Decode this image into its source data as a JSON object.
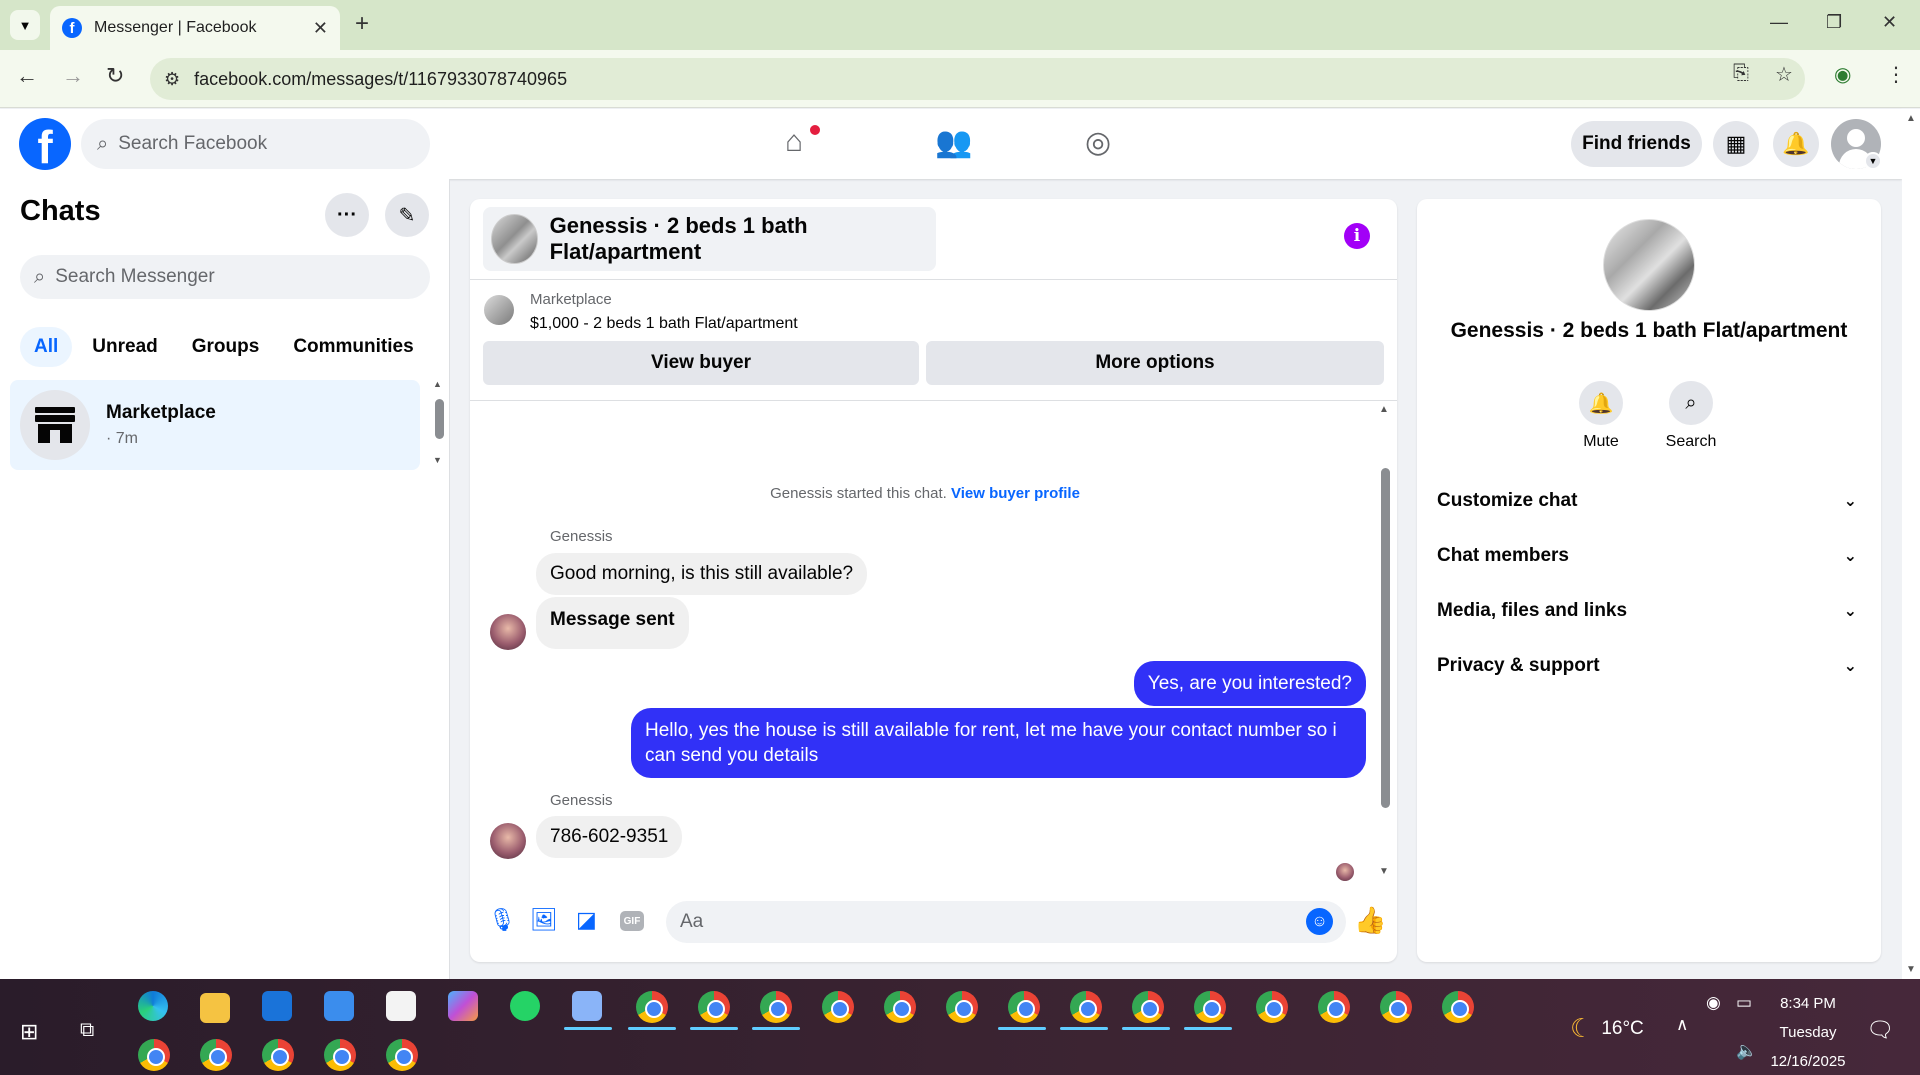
{
  "browser": {
    "tab_title": "Messenger | Facebook",
    "url": "facebook.com/messages/t/1167933078740965"
  },
  "header": {
    "search_placeholder": "Search Facebook",
    "find_friends": "Find friends"
  },
  "sidebar": {
    "title": "Chats",
    "search_placeholder": "Search Messenger",
    "filters": [
      "All",
      "Unread",
      "Groups",
      "Communities"
    ],
    "active_filter": "All",
    "chats": [
      {
        "name": "Marketplace",
        "time": "· 7m"
      }
    ]
  },
  "conversation": {
    "title": "Genessis · 2 beds 1 bath Flat/apartment",
    "marketplace_label": "Marketplace",
    "listing": "$1,000 - 2 beds 1 bath Flat/apartment",
    "view_buyer": "View buyer",
    "more_options": "More options",
    "started_text": "Genessis started this chat.",
    "started_link": "View buyer profile",
    "messages": [
      {
        "sender": "Genessis",
        "text": "Good morning, is this still available?",
        "direction": "in"
      },
      {
        "sender": "",
        "text": "Message sent",
        "direction": "in"
      },
      {
        "sender": "",
        "text": "Yes, are you interested?",
        "direction": "out"
      },
      {
        "sender": "",
        "text": "Hello, yes the house is still available for rent, let me have your contact number so i can send you details",
        "direction": "out"
      },
      {
        "sender": "Genessis",
        "text": "786-602-9351",
        "direction": "in"
      }
    ],
    "composer_placeholder": "Aa",
    "gif_label": "GIF"
  },
  "details": {
    "title": "Genessis · 2 beds 1 bath Flat/apartment",
    "actions": [
      "Mute",
      "Search"
    ],
    "sections": [
      "Customize chat",
      "Chat members",
      "Media, files and links",
      "Privacy & support"
    ]
  },
  "taskbar": {
    "weather": "16°C",
    "time": "8:34 PM",
    "day": "Tuesday",
    "date": "12/16/2025"
  },
  "colors": {
    "facebook_blue": "#0866ff",
    "outgoing_bubble": "#3131f7",
    "info_purple": "#a200f7",
    "notification_red": "#e41e3f"
  }
}
